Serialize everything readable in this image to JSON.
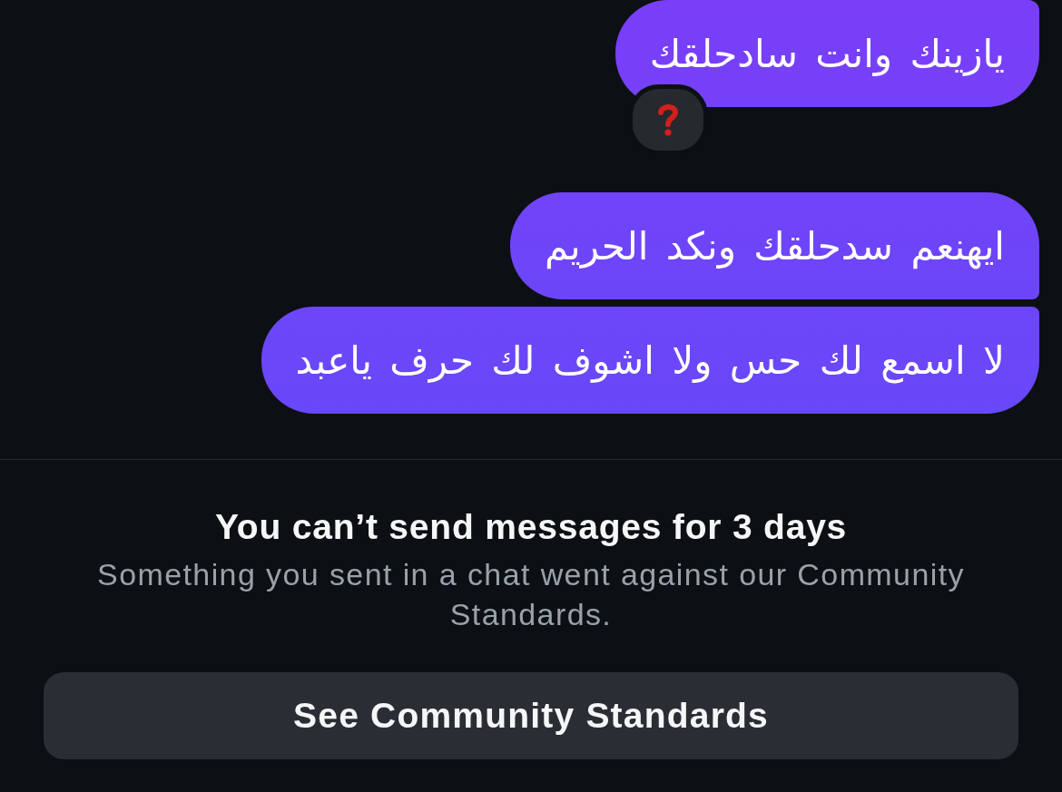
{
  "messages": [
    {
      "text": "يازينك وانت سادحلقك",
      "reaction": {
        "kind": "question"
      }
    },
    {
      "text": "ايهنعم سدحلقك ونكد الحريم"
    },
    {
      "text": "لا اسمع لك حس ولا اشوف لك حرف ياعبد"
    }
  ],
  "notice": {
    "title": "You can’t send messages for 3 days",
    "body": "Something you sent in a chat went against our Community Standards."
  },
  "button": {
    "label": "See Community Standards"
  }
}
